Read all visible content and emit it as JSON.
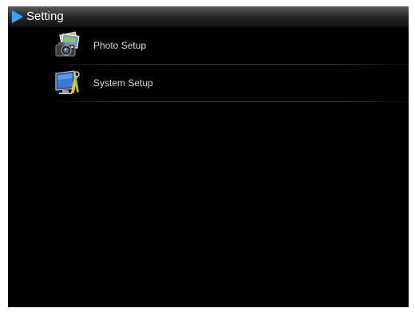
{
  "header": {
    "title": "Setting",
    "arrow_color": "#3e9cff"
  },
  "menu": {
    "items": [
      {
        "label": "Photo Setup",
        "icon": "photo-camera-icon"
      },
      {
        "label": "System Setup",
        "icon": "monitor-tools-icon"
      }
    ]
  },
  "colors": {
    "background": "#000000",
    "text": "#d8d8d8",
    "title_text": "#ffffff"
  }
}
